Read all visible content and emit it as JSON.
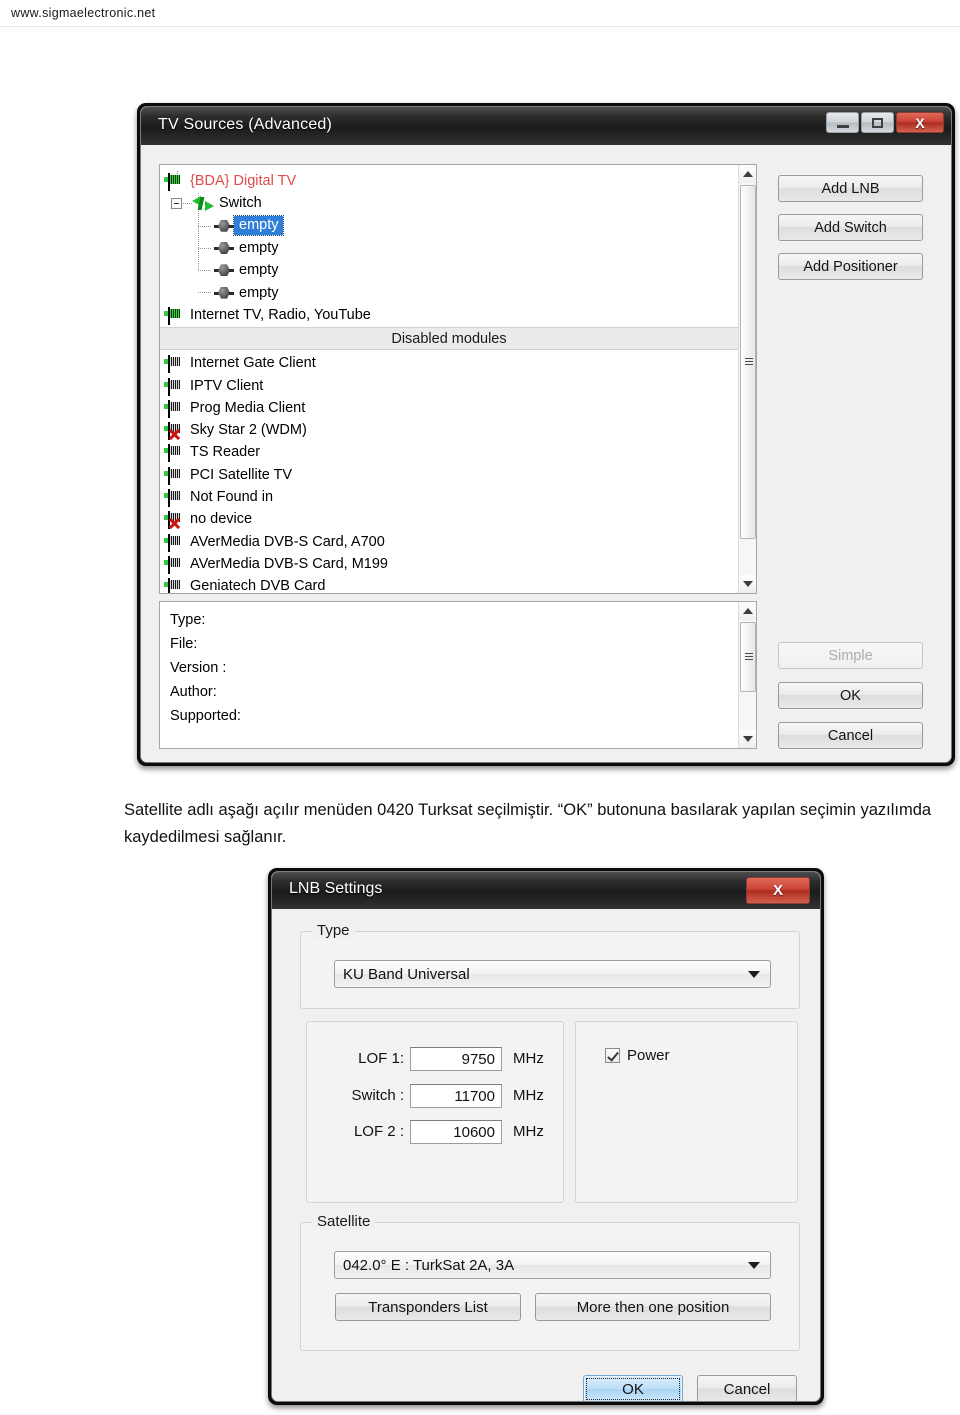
{
  "page": {
    "site_url": "www.sigmaelectronic.net",
    "caption": "Satellite adlı aşağı açılır menüden 0420 Turksat seçilmiştir. “OK” butonuna basılarak yapılan seçimin yazılımda kaydedilmesi sağlanır."
  },
  "colors": {
    "selection_blue": "#2f7fd8",
    "root_red": "#e24a4a",
    "close_red": "#cb4436",
    "icon_green": "#2ecc40",
    "focus_blue": "#bfe0f7"
  },
  "tv_sources_dialog": {
    "title": "TV Sources (Advanced)",
    "window_buttons": {
      "minimize": "minimize-icon",
      "maximize": "maximize-icon",
      "close": "X"
    },
    "tree": {
      "items": [
        {
          "label": "{BDA} Digital TV",
          "icon": "tv-card-icon",
          "level": 0,
          "style": "red"
        },
        {
          "label": "Switch",
          "icon": "switch-icon",
          "level": 1,
          "expander": "collapse"
        },
        {
          "label": "empty",
          "icon": "connector-icon",
          "level": 2,
          "selected": true
        },
        {
          "label": "empty",
          "icon": "connector-icon",
          "level": 2,
          "selected": false
        },
        {
          "label": "empty",
          "icon": "connector-icon",
          "level": 2,
          "selected": false
        },
        {
          "label": "empty",
          "icon": "connector-icon",
          "level": 2,
          "selected": false
        },
        {
          "label": "Internet TV, Radio, YouTube",
          "icon": "tv-card-icon",
          "level": 0,
          "style": "normal"
        }
      ],
      "disabled_header": "Disabled modules",
      "disabled_items": [
        {
          "label": "Internet Gate Client",
          "icon": "tv-card-icon",
          "error": false
        },
        {
          "label": "IPTV Client",
          "icon": "tv-card-icon",
          "error": false
        },
        {
          "label": "Prog Media Client",
          "icon": "tv-card-icon",
          "error": false
        },
        {
          "label": "Sky Star 2 (WDM)",
          "icon": "tv-card-icon",
          "error": true
        },
        {
          "label": "TS Reader",
          "icon": "tv-card-icon",
          "error": false
        },
        {
          "label": "PCI Satellite TV",
          "icon": "tv-card-icon",
          "error": false
        },
        {
          "label": "Not Found in",
          "icon": "tv-card-icon",
          "error": false
        },
        {
          "label": "no device",
          "icon": "tv-card-icon",
          "error": true
        },
        {
          "label": "AVerMedia DVB-S Card, A700",
          "icon": "tv-card-icon",
          "error": false
        },
        {
          "label": "AVerMedia DVB-S Card, M199",
          "icon": "tv-card-icon",
          "error": false
        },
        {
          "label": "Geniatech DVB Card",
          "icon": "tv-card-icon",
          "error": false
        }
      ]
    },
    "details": {
      "rows": [
        {
          "label": "Type:",
          "value": ""
        },
        {
          "label": "File:",
          "value": ""
        },
        {
          "label": "Version :",
          "value": ""
        },
        {
          "label": "Author:",
          "value": ""
        },
        {
          "label": "Supported:",
          "value": ""
        }
      ]
    },
    "buttons": {
      "add_lnb": "Add LNB",
      "add_switch": "Add Switch",
      "add_positioner": "Add Positioner",
      "simple": "Simple",
      "ok": "OK",
      "cancel": "Cancel"
    }
  },
  "lnb_dialog": {
    "title": "LNB Settings",
    "close_label": "X",
    "type_group": {
      "title": "Type",
      "selected": "KU Band Universal"
    },
    "frequency_group": {
      "fields": [
        {
          "label": "LOF 1:",
          "value": "9750",
          "unit": "MHz"
        },
        {
          "label": "Switch :",
          "value": "11700",
          "unit": "MHz"
        },
        {
          "label": "LOF 2 :",
          "value": "10600",
          "unit": "MHz"
        }
      ]
    },
    "power_group": {
      "checkbox_label": "Power",
      "checked": true
    },
    "satellite_group": {
      "title": "Satellite",
      "selected": "042.0° E : TurkSat 2A, 3A",
      "transponders_button": "Transponders List",
      "more_positions_button": "More then one position"
    },
    "buttons": {
      "ok": "OK",
      "cancel": "Cancel"
    }
  }
}
